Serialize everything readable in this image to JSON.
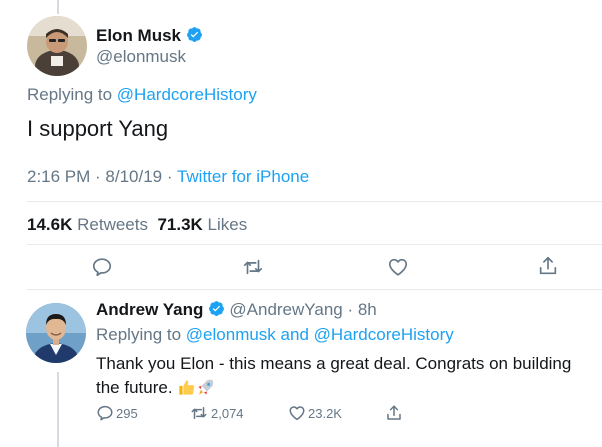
{
  "main_tweet": {
    "author_name": "Elon Musk",
    "author_handle": "@elonmusk",
    "replying_label": "Replying to",
    "replying_to": "@HardcoreHistory",
    "text": "I support Yang",
    "time": "2:16 PM · 8/10/19 · ",
    "source": "Twitter for iPhone",
    "retweets_count": "14.6K",
    "retweets_label": "Retweets",
    "likes_count": "71.3K",
    "likes_label": "Likes"
  },
  "reply_tweet": {
    "author_name": "Andrew Yang",
    "author_handle": "@AndrewYang · 8h",
    "replying_label": "Replying to",
    "replying_to_1": "@elonmusk",
    "replying_and": "and",
    "replying_to_2": "@HardcoreHistory",
    "text": "Thank you Elon - this means a great deal.  Congrats on building the future.",
    "reply_count": "295",
    "retweet_count": "2,074",
    "like_count": "23.2K"
  },
  "icons": {
    "verified": "verified-badge-icon",
    "reply": "reply-icon",
    "retweet": "retweet-icon",
    "like": "heart-icon",
    "share": "share-icon",
    "emoji_1": "thumbs-up-emoji",
    "emoji_2": "rocket-emoji"
  },
  "colors": {
    "link": "#1da1f2",
    "secondary_text": "#657786",
    "primary_text": "#14171a",
    "divider": "#e6ecf0"
  }
}
